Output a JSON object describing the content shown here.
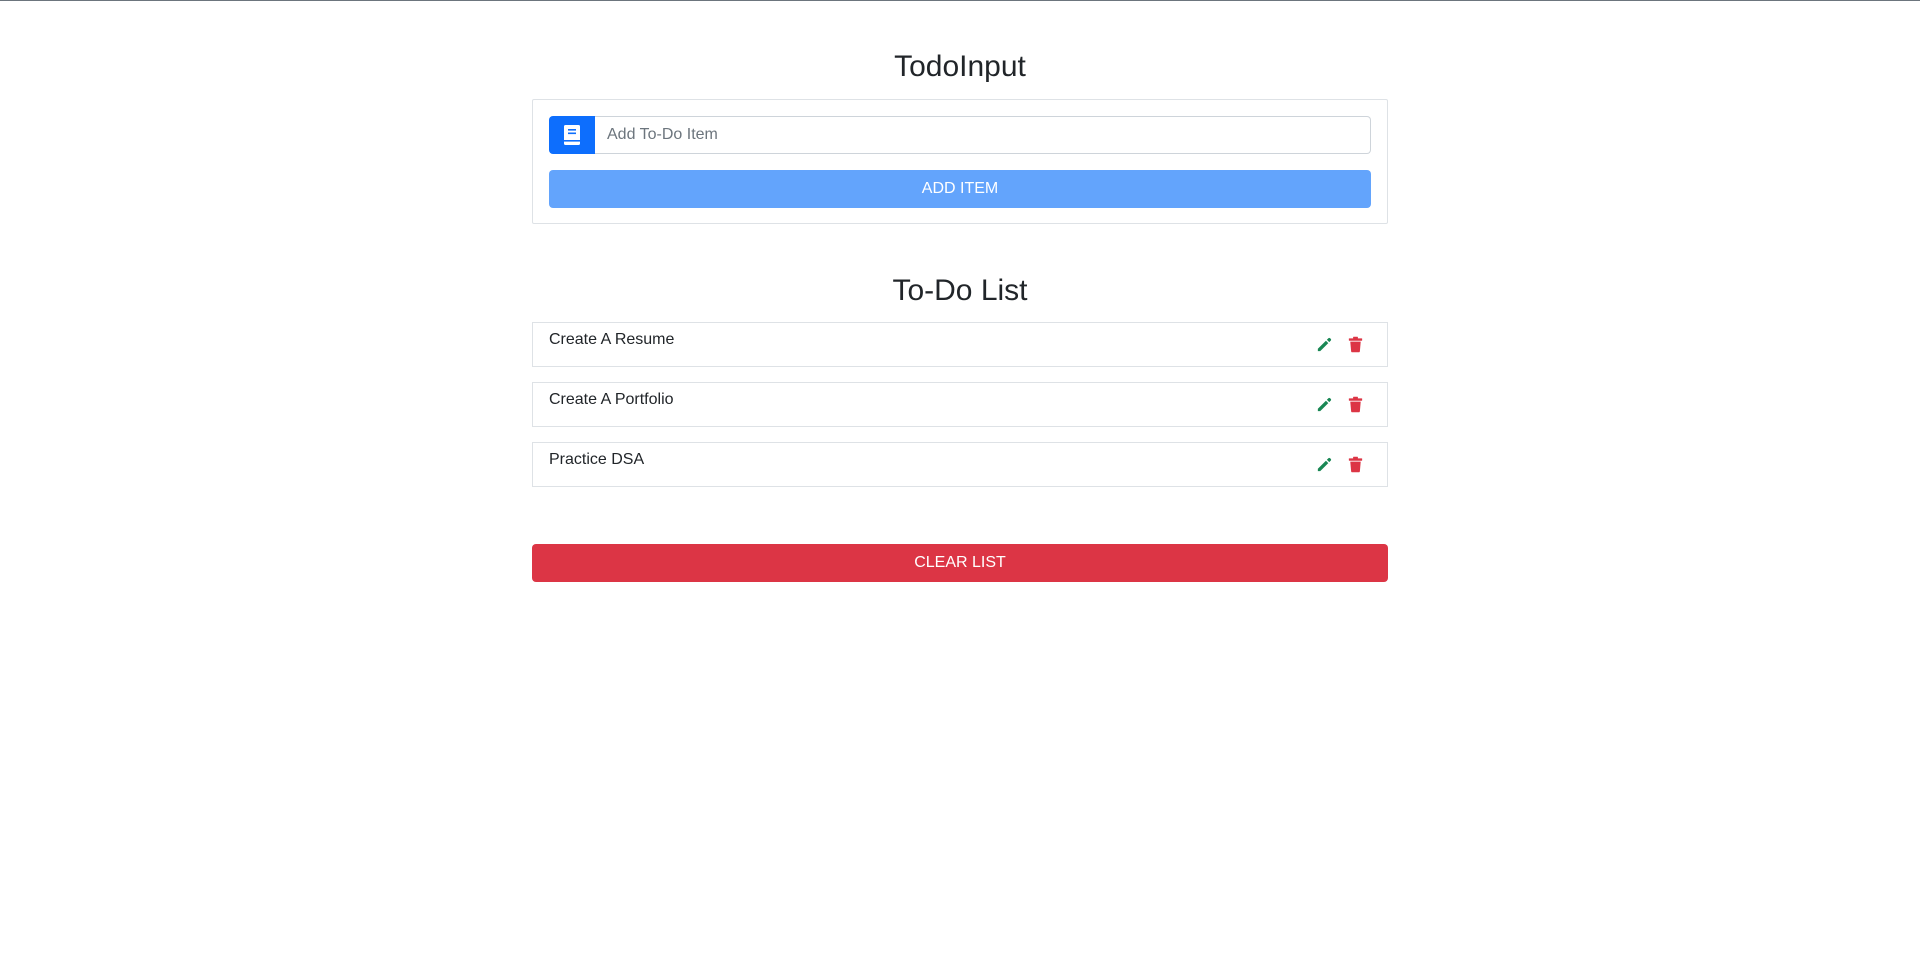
{
  "input_section": {
    "title": "TodoInput",
    "input_placeholder": "Add To-Do Item",
    "input_value": "",
    "input_icon": "book-icon",
    "add_button_label": "ADD ITEM"
  },
  "list_section": {
    "title": "To-Do List",
    "items": [
      {
        "label": "Create A Resume",
        "edit_icon": "pencil-icon",
        "delete_icon": "trash-icon"
      },
      {
        "label": "Create A Portfolio",
        "edit_icon": "pencil-icon",
        "delete_icon": "trash-icon"
      },
      {
        "label": "Practice DSA",
        "edit_icon": "pencil-icon",
        "delete_icon": "trash-icon"
      }
    ],
    "clear_button_label": "CLEAR LIST"
  },
  "colors": {
    "primary": "#0d6efd",
    "add_button": "#63a4fc",
    "edit": "#198754",
    "danger": "#dc3545"
  }
}
